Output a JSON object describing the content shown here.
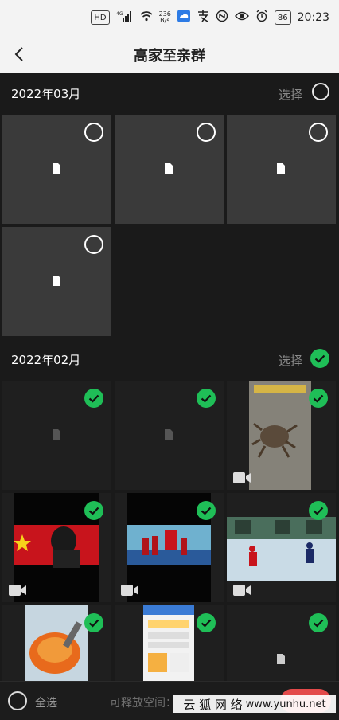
{
  "status": {
    "net_speed_top": "236",
    "net_speed_bottom": "B/s",
    "lte": "4G",
    "battery": "86",
    "time": "20:23",
    "hd": "HD"
  },
  "header": {
    "title": "高家至亲群"
  },
  "sections": [
    {
      "date": "2022年03月",
      "select_label": "选择"
    },
    {
      "date": "2022年02月",
      "select_label": "选择"
    }
  ],
  "footer": {
    "select_all": "全选",
    "free_space": "可释放空间："
  },
  "watermark": {
    "text": "云 狐 网 络",
    "url": "www.yunhu.net"
  },
  "colors": {
    "accent_green": "#1fbe57",
    "delete_red": "#e34a4a"
  }
}
